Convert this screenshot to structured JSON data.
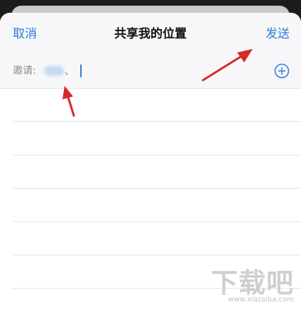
{
  "nav": {
    "cancel_label": "取消",
    "title": "共享我的位置",
    "send_label": "发送"
  },
  "invite": {
    "label": "邀请:",
    "separator": "、",
    "add_icon": "plus-circle-icon"
  },
  "list": {
    "rows": [
      "",
      "",
      "",
      "",
      "",
      "",
      ""
    ]
  },
  "annotations": {
    "arrow_color": "#d62a2a"
  },
  "watermark": {
    "logo": "下载吧",
    "url": "www.xiazaiba.com"
  },
  "colors": {
    "accent": "#2f7ad8",
    "background": "#ffffff",
    "header_background": "#f7f7f9"
  }
}
